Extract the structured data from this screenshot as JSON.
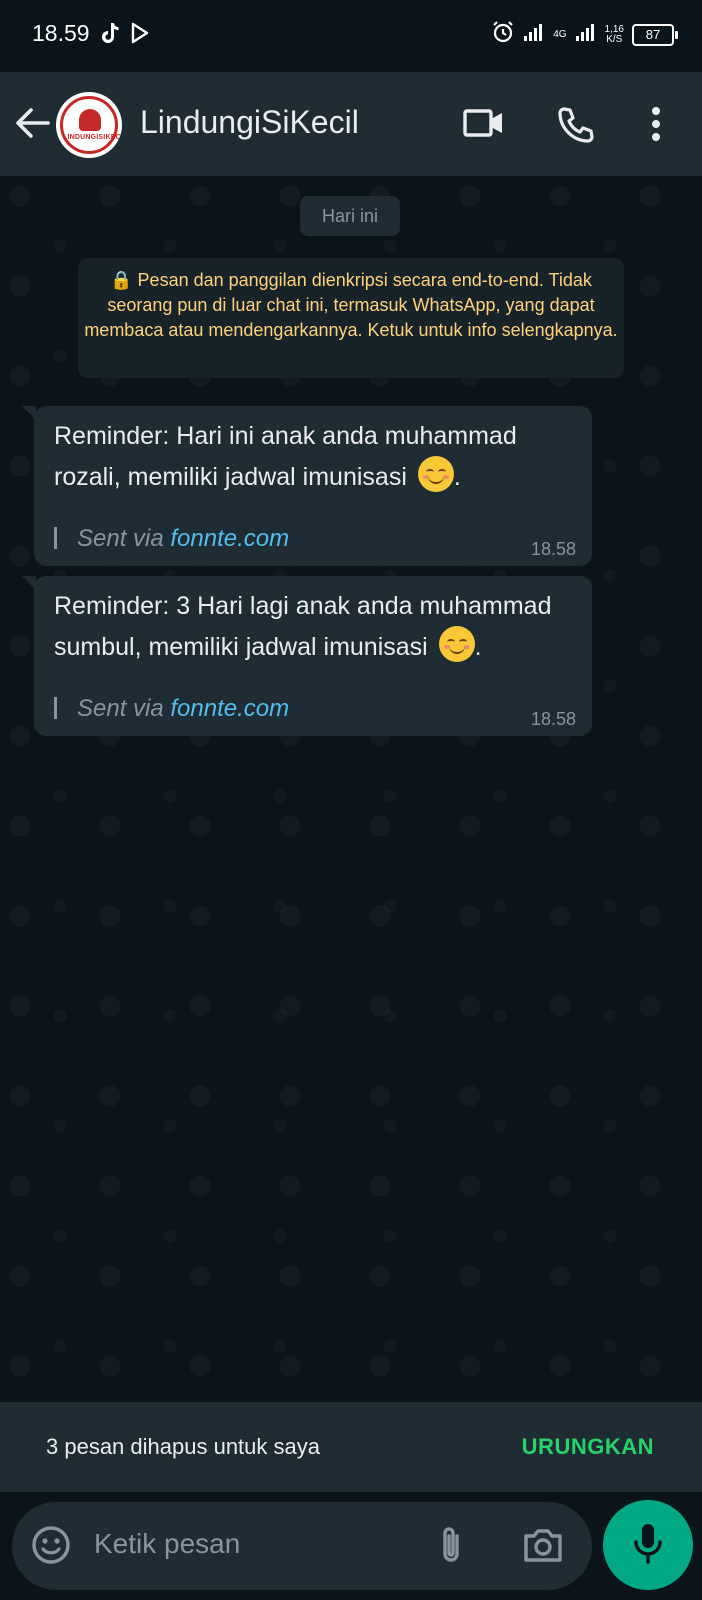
{
  "status_bar": {
    "time": "18.59",
    "network": "4G",
    "speed_value": "1,16",
    "speed_unit": "K/S",
    "battery": "87"
  },
  "header": {
    "title": "LindungiSiKecil",
    "avatar_text": "LINDUNGISIKECIL"
  },
  "chat": {
    "date_chip": "Hari ini",
    "encryption_notice": "🔒 Pesan dan panggilan dienkripsi secara end-to-end. Tidak seorang pun di luar chat ini, termasuk WhatsApp, yang dapat membaca atau mendengarkannya. Ketuk untuk info selengkapnya.",
    "messages": [
      {
        "text": "Reminder: Hari ini anak anda muhammad rozali, memiliki jadwal imunisasi",
        "emoji": "smiling-face",
        "sent_via_label": "Sent via ",
        "sent_via_link": "fonnte.com",
        "time": "18.58"
      },
      {
        "text": "Reminder: 3 Hari lagi anak anda muhammad sumbul, memiliki jadwal imunisasi",
        "emoji": "smiling-face",
        "sent_via_label": "Sent via ",
        "sent_via_link": "fonnte.com",
        "time": "18.58"
      }
    ]
  },
  "deleted_bar": {
    "text": "3 pesan dihapus untuk saya",
    "undo_label": "URUNGKAN"
  },
  "composer": {
    "placeholder": "Ketik pesan"
  },
  "colors": {
    "accent": "#00a884",
    "undo": "#25d366",
    "link": "#53bdeb",
    "notice": "#ffd279"
  }
}
